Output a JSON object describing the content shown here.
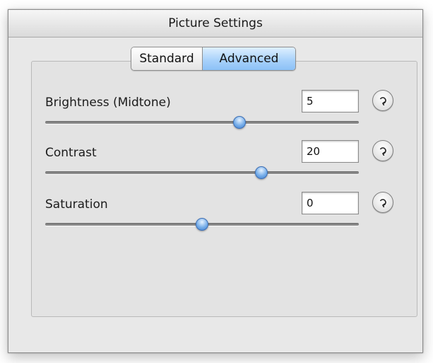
{
  "window": {
    "title": "Picture Settings"
  },
  "tabs": [
    {
      "label": "Standard",
      "selected": false
    },
    {
      "label": "Advanced",
      "selected": true
    }
  ],
  "settings": [
    {
      "label": "Brightness (Midtone)",
      "value": "5",
      "slider_fraction": 0.62,
      "reset_icon": "reset-icon"
    },
    {
      "label": "Contrast",
      "value": "20",
      "slider_fraction": 0.69,
      "reset_icon": "reset-icon"
    },
    {
      "label": "Saturation",
      "value": "0",
      "slider_fraction": 0.5,
      "reset_icon": "reset-icon"
    }
  ],
  "colors": {
    "accent": "#8cc1f6",
    "slider_knob": "#3f7fd0"
  }
}
